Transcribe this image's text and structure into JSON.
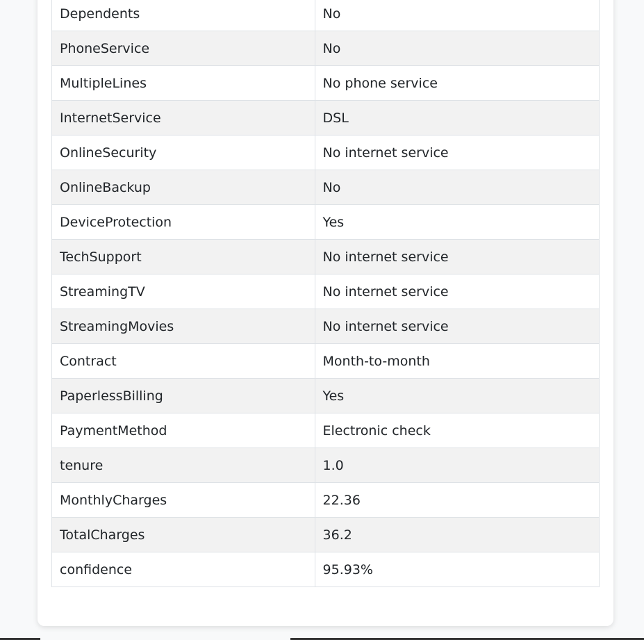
{
  "table": {
    "rows": [
      {
        "key": "Dependents",
        "value": "No"
      },
      {
        "key": "PhoneService",
        "value": "No"
      },
      {
        "key": "MultipleLines",
        "value": "No phone service"
      },
      {
        "key": "InternetService",
        "value": "DSL"
      },
      {
        "key": "OnlineSecurity",
        "value": "No internet service"
      },
      {
        "key": "OnlineBackup",
        "value": "No"
      },
      {
        "key": "DeviceProtection",
        "value": "Yes"
      },
      {
        "key": "TechSupport",
        "value": "No internet service"
      },
      {
        "key": "StreamingTV",
        "value": "No internet service"
      },
      {
        "key": "StreamingMovies",
        "value": "No internet service"
      },
      {
        "key": "Contract",
        "value": "Month-to-month"
      },
      {
        "key": "PaperlessBilling",
        "value": "Yes"
      },
      {
        "key": "PaymentMethod",
        "value": "Electronic check"
      },
      {
        "key": "tenure",
        "value": "1.0"
      },
      {
        "key": "MonthlyCharges",
        "value": "22.36"
      },
      {
        "key": "TotalCharges",
        "value": "36.2"
      },
      {
        "key": "confidence",
        "value": "95.93%"
      }
    ]
  },
  "colors": {
    "page_background": "#f8f9fa",
    "card_background": "#ffffff",
    "row_stripe": "#f2f2f2",
    "border": "#dee2e6",
    "text": "#212529"
  }
}
